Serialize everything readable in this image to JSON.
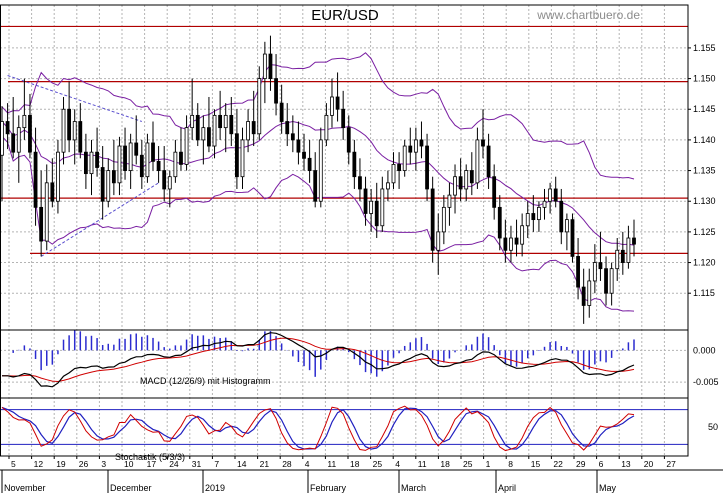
{
  "chart_data": {
    "type": "line",
    "title": "EUR/USD",
    "watermark": "www.chartbuero.de",
    "colors": {
      "background": "#ffffff",
      "grid": "#b4b4b4",
      "candle": "#000000",
      "bollinger": "#7a1fa2",
      "trendline": "#5a4fcf",
      "horizontal_lines": "#b00000",
      "macd_line": "#000000",
      "signal_line": "#d00000",
      "histogram": "#2b2bcf",
      "stoch_k": "#d00000",
      "stoch_d": "#2020c0",
      "stoch_levels": "#2020c0"
    },
    "price_panel": {
      "ylim": [
        1.109,
        1.162
      ],
      "yticks": [
        "1.155",
        "1.150",
        "1.145",
        "1.140",
        "1.135",
        "1.130",
        "1.125",
        "1.120",
        "1.115"
      ],
      "horizontal_lines": [
        1.1585,
        1.1495,
        1.1305,
        1.1215
      ],
      "grid": true
    },
    "macd_panel": {
      "label": "MACD (12/26/9) mit Histogramm",
      "ylim": [
        -0.0075,
        0.0032
      ],
      "yticks": [
        "0.000",
        "-0.005"
      ]
    },
    "stoch_panel": {
      "label": "Stochastik (5/3/3)",
      "ylim": [
        0,
        100
      ],
      "yticks": [
        "50"
      ],
      "levels": [
        80,
        20
      ]
    },
    "x_ticks": [
      "5",
      "12",
      "19",
      "26",
      "3",
      "10",
      "17",
      "24",
      "31",
      "7",
      "14",
      "21",
      "28",
      "4",
      "11",
      "18",
      "25",
      "4",
      "11",
      "18",
      "25",
      "1",
      "8",
      "15",
      "22",
      "29",
      "6",
      "13",
      "20",
      "27"
    ],
    "months": [
      "November",
      "December",
      "2019",
      "February",
      "March",
      "April",
      "May"
    ],
    "candles": [
      [
        1.1375,
        1.1455,
        1.13,
        1.143
      ],
      [
        1.143,
        1.146,
        1.1385,
        1.141
      ],
      [
        1.141,
        1.147,
        1.137,
        1.138
      ],
      [
        1.138,
        1.144,
        1.133,
        1.142
      ],
      [
        1.142,
        1.15,
        1.14,
        1.144
      ],
      [
        1.144,
        1.1475,
        1.137,
        1.138
      ],
      [
        1.138,
        1.142,
        1.126,
        1.129
      ],
      [
        1.129,
        1.135,
        1.121,
        1.1235
      ],
      [
        1.1235,
        1.136,
        1.122,
        1.133
      ],
      [
        1.133,
        1.137,
        1.129,
        1.13
      ],
      [
        1.13,
        1.14,
        1.128,
        1.138
      ],
      [
        1.138,
        1.147,
        1.136,
        1.145
      ],
      [
        1.145,
        1.1495,
        1.138,
        1.14
      ],
      [
        1.14,
        1.145,
        1.136,
        1.143
      ],
      [
        1.143,
        1.146,
        1.137,
        1.138
      ],
      [
        1.138,
        1.141,
        1.132,
        1.1345
      ],
      [
        1.1345,
        1.14,
        1.131,
        1.138
      ],
      [
        1.138,
        1.142,
        1.134,
        1.1355
      ],
      [
        1.1355,
        1.139,
        1.127,
        1.13
      ],
      [
        1.13,
        1.137,
        1.129,
        1.135
      ],
      [
        1.135,
        1.14,
        1.131,
        1.133
      ],
      [
        1.133,
        1.1405,
        1.131,
        1.139
      ],
      [
        1.139,
        1.142,
        1.1335,
        1.135
      ],
      [
        1.135,
        1.141,
        1.132,
        1.1395
      ],
      [
        1.1395,
        1.144,
        1.136,
        1.1375
      ],
      [
        1.1375,
        1.14,
        1.132,
        1.134
      ],
      [
        1.134,
        1.141,
        1.133,
        1.1395
      ],
      [
        1.1395,
        1.143,
        1.135,
        1.1365
      ],
      [
        1.1365,
        1.139,
        1.133,
        1.135
      ],
      [
        1.135,
        1.139,
        1.13,
        1.132
      ],
      [
        1.132,
        1.135,
        1.129,
        1.134
      ],
      [
        1.134,
        1.14,
        1.133,
        1.138
      ],
      [
        1.138,
        1.142,
        1.135,
        1.136
      ],
      [
        1.136,
        1.144,
        1.135,
        1.142
      ],
      [
        1.142,
        1.15,
        1.14,
        1.144
      ],
      [
        1.144,
        1.146,
        1.139,
        1.14
      ],
      [
        1.14,
        1.144,
        1.136,
        1.142
      ],
      [
        1.142,
        1.147,
        1.138,
        1.139
      ],
      [
        1.139,
        1.145,
        1.137,
        1.144
      ],
      [
        1.144,
        1.148,
        1.14,
        1.142
      ],
      [
        1.142,
        1.146,
        1.138,
        1.144
      ],
      [
        1.144,
        1.147,
        1.139,
        1.141
      ],
      [
        1.141,
        1.145,
        1.132,
        1.134
      ],
      [
        1.134,
        1.142,
        1.132,
        1.14
      ],
      [
        1.14,
        1.145,
        1.138,
        1.143
      ],
      [
        1.143,
        1.148,
        1.139,
        1.141
      ],
      [
        1.141,
        1.152,
        1.14,
        1.15
      ],
      [
        1.15,
        1.156,
        1.146,
        1.154
      ],
      [
        1.154,
        1.157,
        1.148,
        1.15
      ],
      [
        1.15,
        1.154,
        1.144,
        1.146
      ],
      [
        1.146,
        1.149,
        1.141,
        1.143
      ],
      [
        1.143,
        1.146,
        1.139,
        1.141
      ],
      [
        1.141,
        1.144,
        1.138,
        1.14
      ],
      [
        1.14,
        1.143,
        1.136,
        1.138
      ],
      [
        1.138,
        1.141,
        1.135,
        1.137
      ],
      [
        1.137,
        1.14,
        1.133,
        1.135
      ],
      [
        1.135,
        1.138,
        1.129,
        1.13
      ],
      [
        1.13,
        1.142,
        1.129,
        1.14
      ],
      [
        1.14,
        1.146,
        1.139,
        1.144
      ],
      [
        1.144,
        1.15,
        1.142,
        1.147
      ],
      [
        1.147,
        1.151,
        1.143,
        1.145
      ],
      [
        1.145,
        1.148,
        1.14,
        1.142
      ],
      [
        1.142,
        1.144,
        1.136,
        1.138
      ],
      [
        1.138,
        1.14,
        1.132,
        1.134
      ],
      [
        1.134,
        1.137,
        1.13,
        1.132
      ],
      [
        1.132,
        1.134,
        1.126,
        1.128
      ],
      [
        1.128,
        1.132,
        1.125,
        1.13
      ],
      [
        1.13,
        1.133,
        1.124,
        1.126
      ],
      [
        1.126,
        1.134,
        1.125,
        1.132
      ],
      [
        1.132,
        1.135,
        1.13,
        1.133
      ],
      [
        1.133,
        1.138,
        1.132,
        1.136
      ],
      [
        1.136,
        1.138,
        1.132,
        1.135
      ],
      [
        1.135,
        1.14,
        1.134,
        1.139
      ],
      [
        1.139,
        1.142,
        1.136,
        1.138
      ],
      [
        1.138,
        1.142,
        1.135,
        1.14
      ],
      [
        1.14,
        1.143,
        1.137,
        1.139
      ],
      [
        1.139,
        1.141,
        1.13,
        1.132
      ],
      [
        1.132,
        1.134,
        1.12,
        1.122
      ],
      [
        1.122,
        1.128,
        1.118,
        1.125
      ],
      [
        1.125,
        1.131,
        1.123,
        1.129
      ],
      [
        1.129,
        1.133,
        1.126,
        1.131
      ],
      [
        1.131,
        1.136,
        1.128,
        1.134
      ],
      [
        1.134,
        1.137,
        1.13,
        1.132
      ],
      [
        1.132,
        1.136,
        1.13,
        1.135
      ],
      [
        1.135,
        1.138,
        1.131,
        1.133
      ],
      [
        1.133,
        1.142,
        1.132,
        1.14
      ],
      [
        1.14,
        1.145,
        1.137,
        1.139
      ],
      [
        1.139,
        1.141,
        1.132,
        1.134
      ],
      [
        1.134,
        1.136,
        1.127,
        1.129
      ],
      [
        1.129,
        1.131,
        1.122,
        1.124
      ],
      [
        1.124,
        1.127,
        1.12,
        1.122
      ],
      [
        1.122,
        1.126,
        1.12,
        1.124
      ],
      [
        1.124,
        1.127,
        1.121,
        1.123
      ],
      [
        1.123,
        1.128,
        1.121,
        1.126
      ],
      [
        1.126,
        1.13,
        1.124,
        1.128
      ],
      [
        1.128,
        1.131,
        1.125,
        1.127
      ],
      [
        1.127,
        1.13,
        1.125,
        1.129
      ],
      [
        1.129,
        1.132,
        1.127,
        1.13
      ],
      [
        1.13,
        1.133,
        1.128,
        1.132
      ],
      [
        1.132,
        1.134,
        1.129,
        1.13
      ],
      [
        1.13,
        1.132,
        1.123,
        1.125
      ],
      [
        1.125,
        1.128,
        1.122,
        1.127
      ],
      [
        1.127,
        1.128,
        1.12,
        1.121
      ],
      [
        1.121,
        1.124,
        1.114,
        1.116
      ],
      [
        1.116,
        1.119,
        1.11,
        1.113
      ],
      [
        1.113,
        1.119,
        1.111,
        1.117
      ],
      [
        1.117,
        1.123,
        1.115,
        1.12
      ],
      [
        1.12,
        1.125,
        1.117,
        1.119
      ],
      [
        1.119,
        1.121,
        1.113,
        1.115
      ],
      [
        1.115,
        1.12,
        1.113,
        1.119
      ],
      [
        1.119,
        1.124,
        1.117,
        1.122
      ],
      [
        1.122,
        1.125,
        1.118,
        1.12
      ],
      [
        1.12,
        1.126,
        1.119,
        1.124
      ],
      [
        1.124,
        1.127,
        1.121,
        1.123
      ]
    ]
  }
}
